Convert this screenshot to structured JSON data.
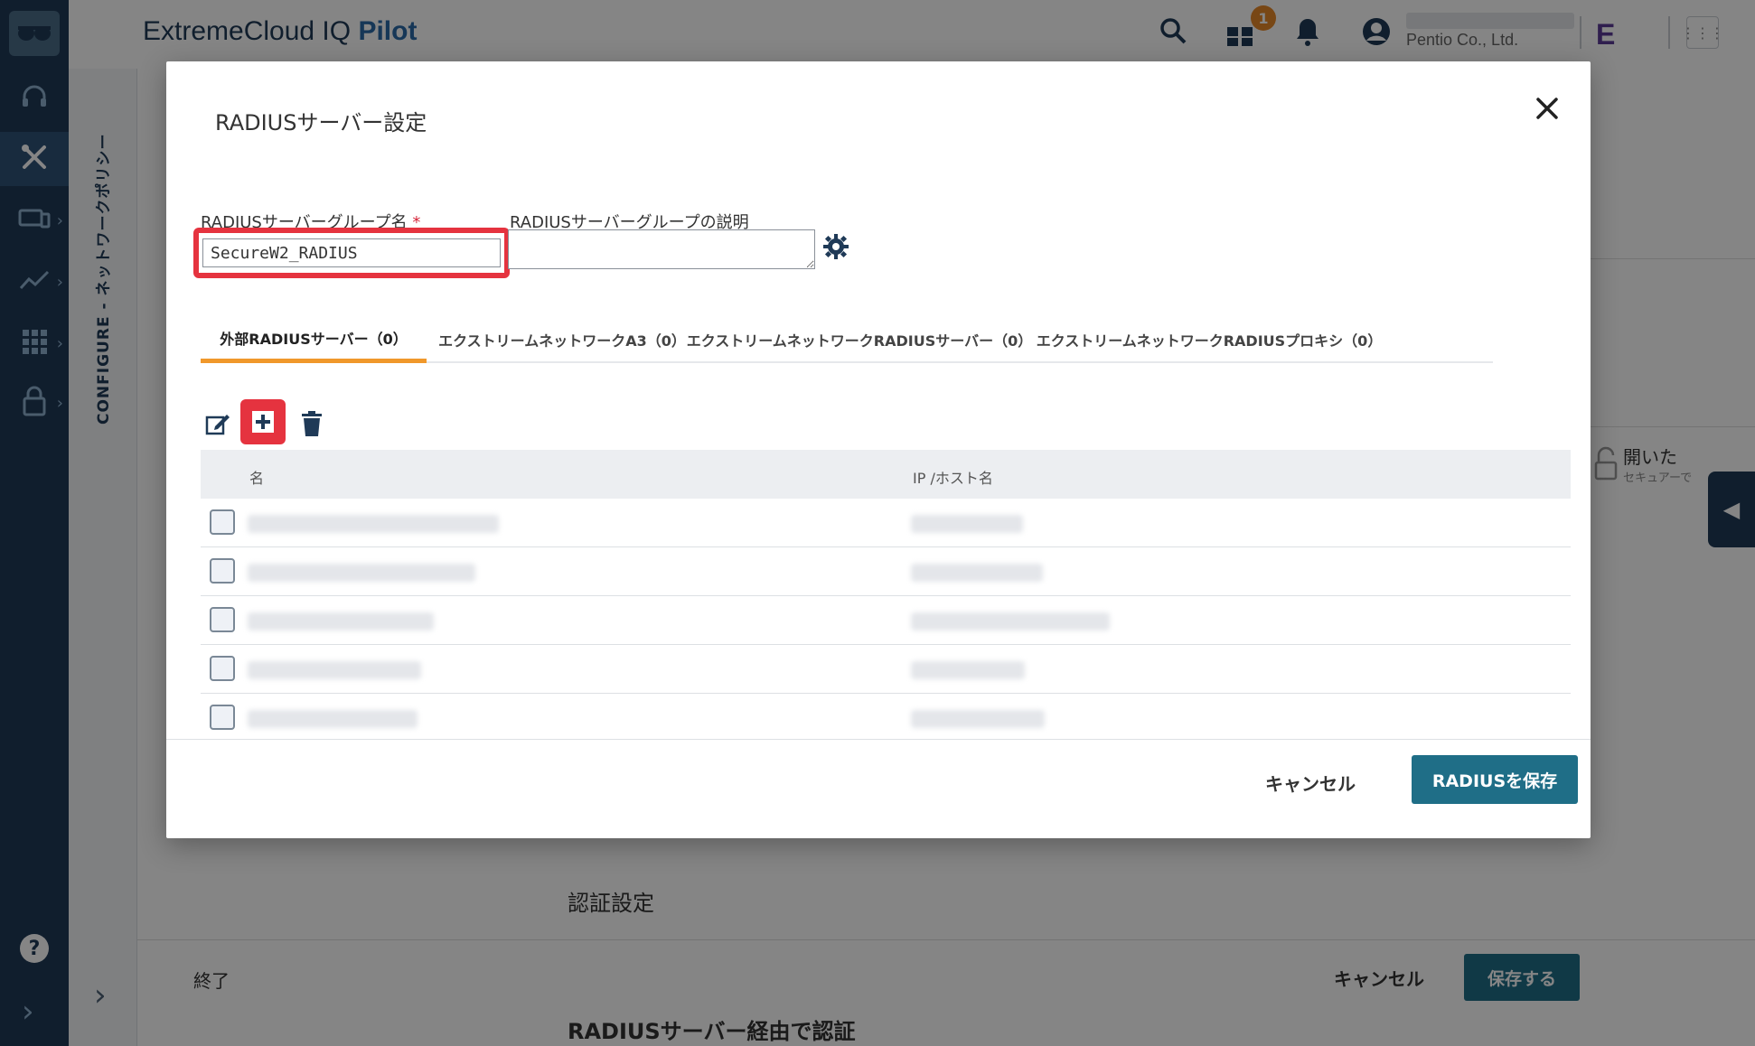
{
  "app": {
    "title_main": "ExtremeCloud",
    "title_tm": "IQ",
    "title_pilot": "Pilot",
    "notification_count": "1",
    "org_name": "Pentio Co., Ltd.",
    "vendor_logo": "E"
  },
  "sidebar": {
    "items": [
      {
        "icon": "headset-icon"
      },
      {
        "icon": "tools-icon"
      },
      {
        "icon": "devices-icon"
      },
      {
        "icon": "analytics-icon"
      },
      {
        "icon": "apps-icon"
      },
      {
        "icon": "lock-icon"
      }
    ],
    "help": "?"
  },
  "rail": {
    "label": "CONFIGURE - ネットワークポリシー"
  },
  "background": {
    "open_label": "開いた",
    "open_sub": "セキュアーで",
    "section_title": "認証設定",
    "section_title2": "RADIUSサーバー経由で認証",
    "end_label": "終了",
    "cancel_label": "キャンセル",
    "save_label": "保存する"
  },
  "modal": {
    "title": "RADIUSサーバー設定",
    "group_name_label": "RADIUSサーバーグループ名",
    "required_mark": "*",
    "group_name_value": "SecureW2_RADIUS",
    "description_label": "RADIUSサーバーグループの説明",
    "description_value": "",
    "tabs": [
      {
        "label": "外部RADIUSサーバー（0）"
      },
      {
        "label": "エクストリームネットワークA3（0）"
      },
      {
        "label": "エクストリームネットワークRADIUSサーバー（0）"
      },
      {
        "label": "エクストリームネットワークRADIUSプロキシ（0）"
      }
    ],
    "table": {
      "columns": [
        "名",
        "IP /ホスト名"
      ]
    },
    "cancel_label": "キャンセル",
    "save_label": "RADIUSを保存"
  },
  "colors": {
    "primary": "#1f6e87",
    "highlight": "#e5333f",
    "tab_accent": "#f0982b",
    "sidebar": "#1f3a57"
  }
}
